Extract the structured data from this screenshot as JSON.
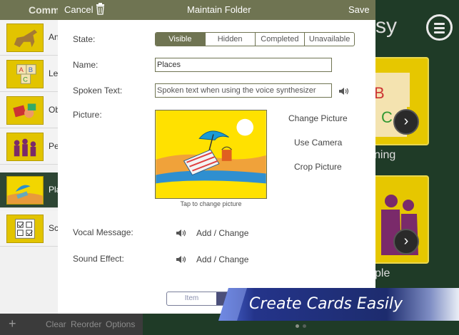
{
  "background": {
    "left_header": "Comm",
    "categories": [
      {
        "label": "An",
        "icon": "horse-icon"
      },
      {
        "label": "Le",
        "icon": "abc-blocks-icon"
      },
      {
        "label": "Ob",
        "icon": "toys-icon"
      },
      {
        "label": "Pe",
        "icon": "people-icon"
      },
      {
        "label": "Pla",
        "icon": "beach-icon",
        "selected": true
      },
      {
        "label": "Sc",
        "icon": "checklist-icon"
      }
    ],
    "footer": {
      "add": "+",
      "clear": "Clear",
      "reorder": "Reorder",
      "options": "Options"
    },
    "app_title": "sy",
    "card_labels": [
      "ning",
      "ple"
    ]
  },
  "nav": {
    "cancel": "Cancel",
    "title": "Maintain Folder",
    "save": "Save"
  },
  "form": {
    "state_label": "State:",
    "state_options": [
      "Visible",
      "Hidden",
      "Completed",
      "Unavailable"
    ],
    "state_selected": "Visible",
    "name_label": "Name:",
    "name_value": "Places",
    "spoken_label": "Spoken Text:",
    "spoken_placeholder": "Spoken text when using the voice synthesizer",
    "picture_label": "Picture:",
    "picture_caption": "Tap to change picture",
    "change_picture": "Change Picture",
    "use_camera": "Use Camera",
    "crop_picture": "Crop Picture",
    "vocal_label": "Vocal Message:",
    "vocal_action": "Add / Change",
    "sound_label": "Sound Effect:",
    "sound_action": "Add / Change"
  },
  "bottom_tabs": [
    "Item",
    ""
  ],
  "banner": {
    "text": "Create Cards Easily"
  },
  "colors": {
    "nav_bar": "#6f7452",
    "accent_yellow": "#e6c700",
    "banner_blue": "#1f2f78",
    "dark_green": "#1f3b27"
  }
}
